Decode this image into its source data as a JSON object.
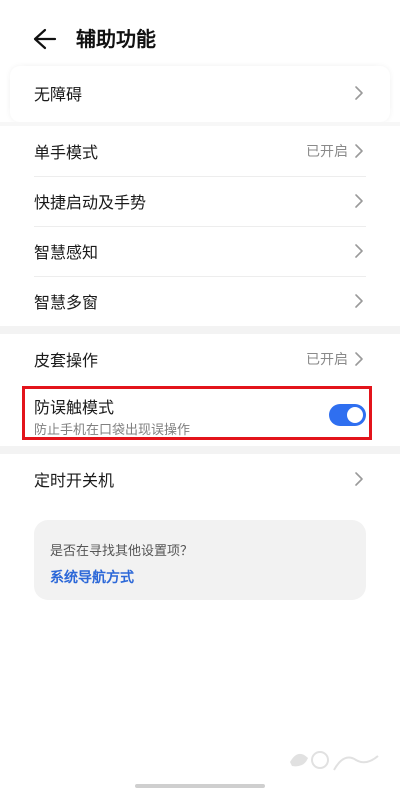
{
  "header": {
    "title": "辅助功能"
  },
  "items": [
    {
      "label": "无障碍"
    },
    {
      "label": "单手模式",
      "status": "已开启"
    },
    {
      "label": "快捷启动及手势"
    },
    {
      "label": "智慧感知"
    },
    {
      "label": "智慧多窗"
    },
    {
      "label": "皮套操作",
      "status": "已开启"
    },
    {
      "label": "定时开关机"
    }
  ],
  "toggle_item": {
    "label": "防误触模式",
    "sublabel": "防止手机在口袋出现误操作",
    "enabled": true
  },
  "suggestion_card": {
    "question": "是否在寻找其他设置项？",
    "link": "系统导航方式"
  },
  "colors": {
    "accent": "#2f6ff0",
    "highlight_border": "#e3141b",
    "link": "#2c68d8"
  }
}
